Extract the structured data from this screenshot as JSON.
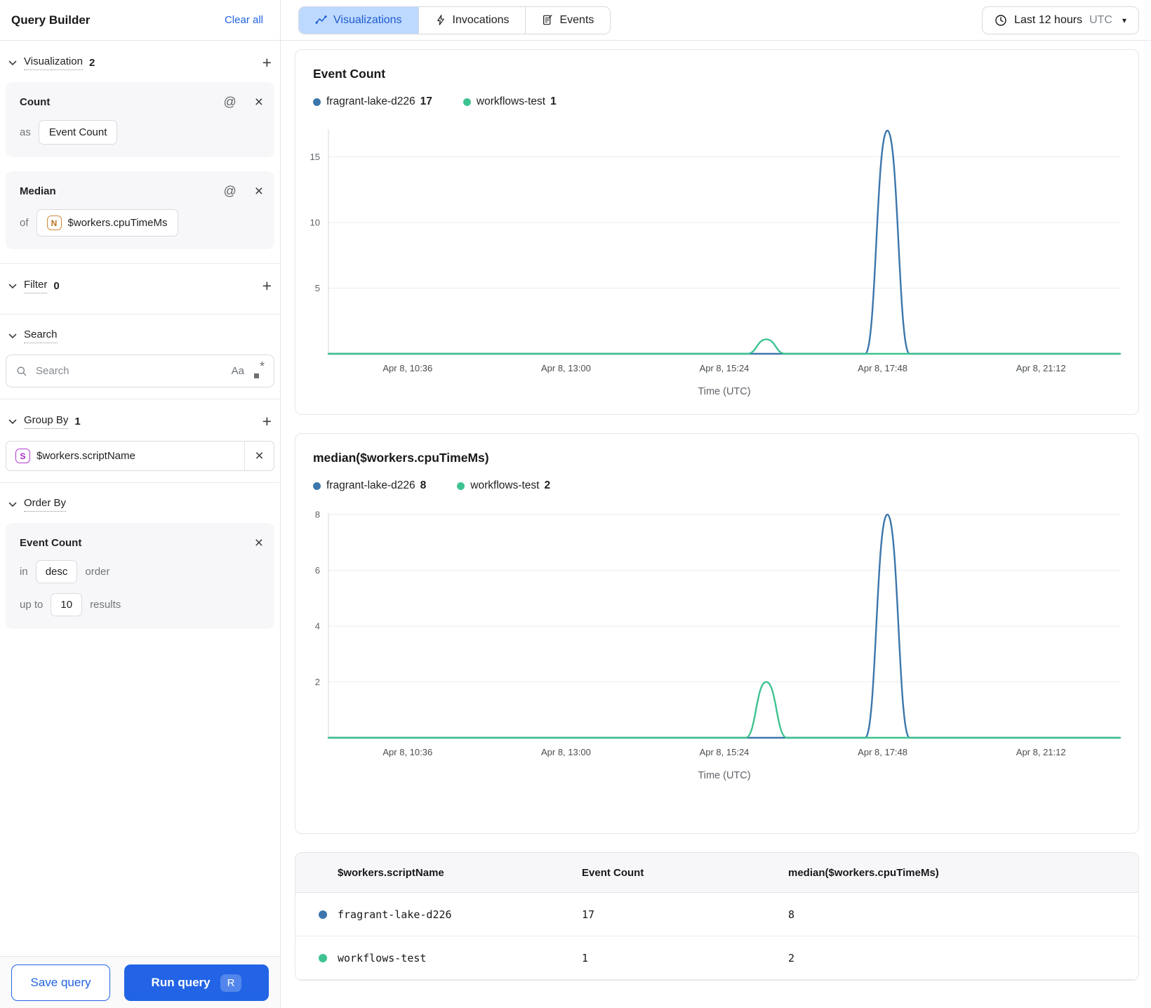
{
  "colors": {
    "accent": "#2264E5",
    "series_blue": "#3C76AC",
    "series_green": "#3EC390",
    "active_tab_bg": "#BED9FF",
    "active_tab_text": "#1D5BD0"
  },
  "icons": {
    "plus": "+",
    "close": "×",
    "at": "@",
    "caret_down": "▾",
    "case_sensitive": "Aa",
    "regex_asterisk": "*"
  },
  "sidebar": {
    "title": "Query Builder",
    "clear_all": "Clear all",
    "visualization_section": {
      "label": "Visualization",
      "count": "2"
    },
    "cards": [
      {
        "name": "Count",
        "prefix": "as",
        "value": "Event Count"
      },
      {
        "name": "Median",
        "prefix": "of",
        "value": "$workers.cpuTimeMs",
        "badge": "N"
      }
    ],
    "filter_section": {
      "label": "Filter",
      "count": "0"
    },
    "search_section": {
      "label": "Search",
      "placeholder": "Search"
    },
    "group_by_section": {
      "label": "Group By",
      "count": "1",
      "item": {
        "badge": "S",
        "value": "$workers.scriptName"
      }
    },
    "order_by_section": {
      "label": "Order By",
      "item": {
        "name": "Event Count",
        "in_label": "in",
        "direction": "desc",
        "order_label": "order",
        "limit_label": "up to",
        "limit": "10",
        "results_label": "results"
      }
    },
    "footer": {
      "save": "Save query",
      "run": "Run query",
      "shortcut": "R"
    }
  },
  "topbar": {
    "tabs": [
      {
        "label": "Visualizations",
        "active": true
      },
      {
        "label": "Invocations",
        "active": false
      },
      {
        "label": "Events",
        "active": false
      }
    ],
    "time_range": {
      "label": "Last 12 hours",
      "timezone": "UTC"
    }
  },
  "chart_data": [
    {
      "type": "line",
      "title": "Event Count",
      "xlabel": "Time (UTC)",
      "x_ticks": [
        "Apr 8, 10:36",
        "Apr 8, 13:00",
        "Apr 8, 15:24",
        "Apr 8, 17:48",
        "Apr 8, 21:12"
      ],
      "y_ticks": [
        5,
        10,
        15
      ],
      "ylim": [
        0,
        17
      ],
      "grid": true,
      "legend_position": "top",
      "legend": [
        {
          "name": "fragrant-lake-d226",
          "value": 17,
          "color": "series_blue"
        },
        {
          "name": "workflows-test",
          "value": 1,
          "color": "series_green"
        }
      ],
      "series": [
        {
          "name": "fragrant-lake-d226",
          "color": "series_blue",
          "baseline": 0,
          "spikes": [
            {
              "x": 0.706,
              "half_width": 0.028,
              "peak": 17
            }
          ]
        },
        {
          "name": "workflows-test",
          "color": "series_green",
          "baseline": 0,
          "spikes": [
            {
              "x": 0.553,
              "half_width": 0.024,
              "peak": 1.1
            }
          ]
        }
      ]
    },
    {
      "type": "line",
      "title": "median($workers.cpuTimeMs)",
      "xlabel": "Time (UTC)",
      "x_ticks": [
        "Apr 8, 10:36",
        "Apr 8, 13:00",
        "Apr 8, 15:24",
        "Apr 8, 17:48",
        "Apr 8, 21:12"
      ],
      "y_ticks": [
        2,
        4,
        6,
        8
      ],
      "ylim": [
        0,
        8
      ],
      "grid": true,
      "legend_position": "top",
      "legend": [
        {
          "name": "fragrant-lake-d226",
          "value": 8,
          "color": "series_blue"
        },
        {
          "name": "workflows-test",
          "value": 2,
          "color": "series_green"
        }
      ],
      "series": [
        {
          "name": "fragrant-lake-d226",
          "color": "series_blue",
          "baseline": 0,
          "spikes": [
            {
              "x": 0.706,
              "half_width": 0.028,
              "peak": 8
            }
          ]
        },
        {
          "name": "workflows-test",
          "color": "series_green",
          "baseline": 0,
          "spikes": [
            {
              "x": 0.553,
              "half_width": 0.026,
              "peak": 2
            }
          ]
        }
      ]
    }
  ],
  "table": {
    "columns": [
      "$workers.scriptName",
      "Event Count",
      "median($workers.cpuTimeMs)"
    ],
    "rows": [
      {
        "color": "series_blue",
        "name": "fragrant-lake-d226",
        "event_count": "17",
        "median": "8"
      },
      {
        "color": "series_green",
        "name": "workflows-test",
        "event_count": "1",
        "median": "2"
      }
    ]
  }
}
